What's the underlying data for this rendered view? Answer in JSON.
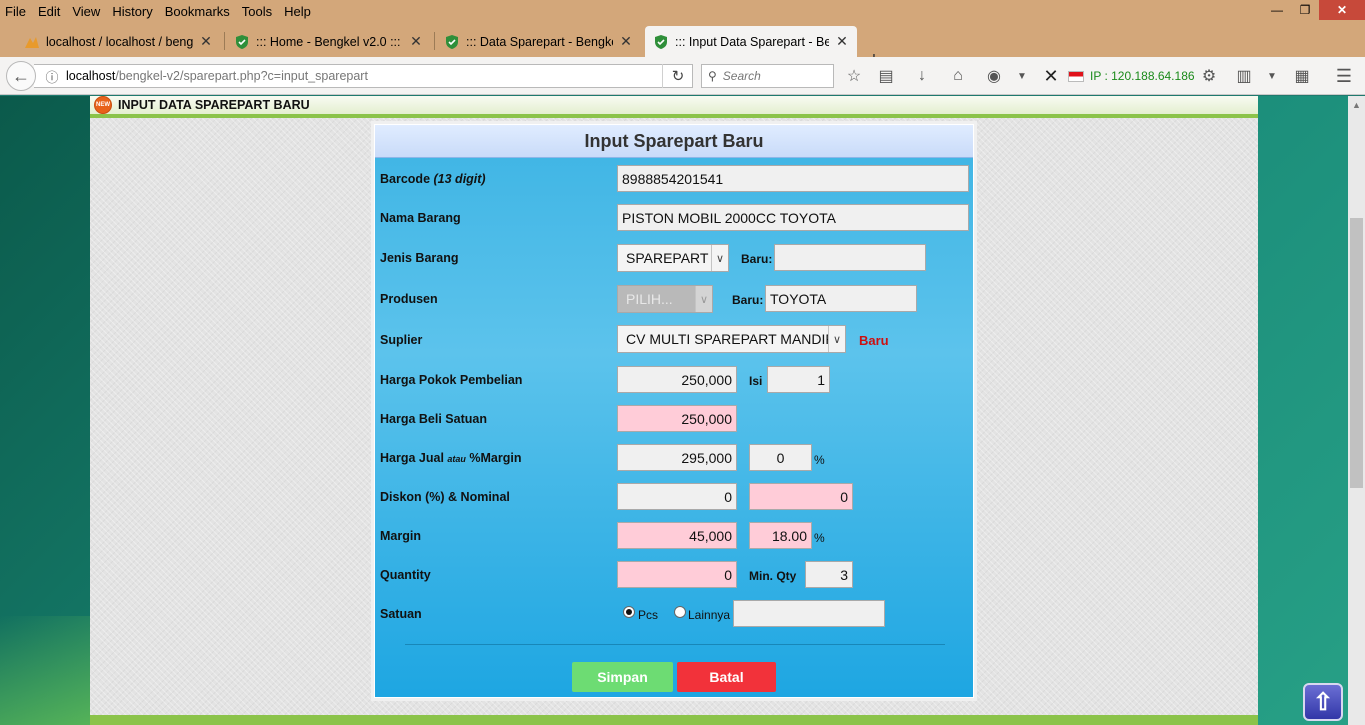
{
  "menu": [
    "File",
    "Edit",
    "View",
    "History",
    "Bookmarks",
    "Tools",
    "Help"
  ],
  "tabs": [
    {
      "label": "localhost / localhost / bengk",
      "icon": "pma-icon"
    },
    {
      "label": "::: Home - Bengkel v2.0 :::",
      "icon": "shield-icon"
    },
    {
      "label": "::: Data Sparepart - Bengkel v",
      "icon": "shield-icon"
    },
    {
      "label": "::: Input Data Sparepart - Ber",
      "icon": "shield-icon"
    }
  ],
  "url": {
    "host": "localhost",
    "path": "/bengkel-v2/sparepart.php?c=input_sparepart"
  },
  "search_placeholder": "Search",
  "ip_label": "IP : 120.188.64.186",
  "page": {
    "badge": "NEW",
    "title": "INPUT DATA SPAREPART BARU"
  },
  "form": {
    "title": "Input Sparepart Baru",
    "barcode": {
      "label": "Barcode",
      "hint": "(13 digit)",
      "value": "8988854201541"
    },
    "nama_barang": {
      "label": "Nama Barang",
      "value": "PISTON MOBIL 2000CC TOYOTA"
    },
    "jenis_barang": {
      "label": "Jenis Barang",
      "selected": "SPAREPART",
      "baru_label": "Baru:",
      "baru_value": ""
    },
    "produsen": {
      "label": "Produsen",
      "selected": "PILIH...",
      "baru_label": "Baru:",
      "baru_value": "TOYOTA"
    },
    "suplier": {
      "label": "Suplier",
      "selected": "CV MULTI SPAREPART MANDIRI",
      "baru_link": "Baru"
    },
    "harga_pokok": {
      "label": "Harga Pokok Pembelian",
      "value": "250,000",
      "isi_label": "Isi",
      "isi_value": "1"
    },
    "harga_beli_satuan": {
      "label": "Harga Beli Satuan",
      "value": "250,000"
    },
    "harga_jual": {
      "label_a": "Harga Jual",
      "label_b": "atau",
      "label_c": "%Margin",
      "value": "295,000",
      "margin_pct": "0",
      "pct_sign": "%"
    },
    "diskon": {
      "label": "Diskon (%) & Nominal",
      "pct": "0",
      "nominal": "0"
    },
    "margin": {
      "label": "Margin",
      "value": "45,000",
      "pct": "18.00",
      "pct_sign": "%"
    },
    "quantity": {
      "label": "Quantity",
      "value": "0",
      "min_label": "Min. Qty",
      "min_value": "3"
    },
    "satuan": {
      "label": "Satuan",
      "opt1": "Pcs",
      "opt2": "Lainnya",
      "other_value": ""
    },
    "btn_simpan": "Simpan",
    "btn_batal": "Batal"
  }
}
